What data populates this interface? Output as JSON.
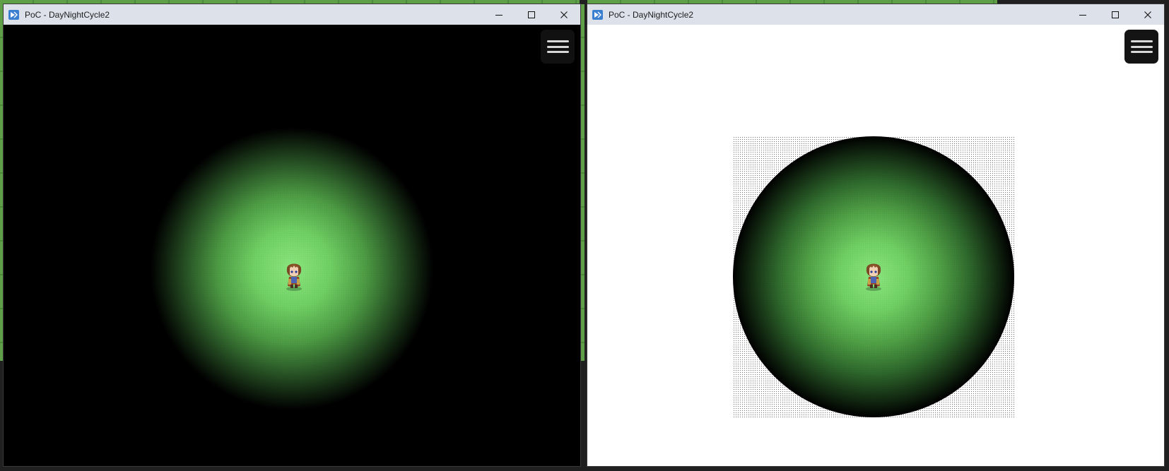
{
  "windows": [
    {
      "title": "PoC - DayNightCycle2",
      "controls": {
        "minimize": "minimize-icon",
        "maximize": "maximize-icon",
        "close": "close-icon"
      },
      "menu_button": "hamburger-menu-icon"
    },
    {
      "title": "PoC - DayNightCycle2",
      "controls": {
        "minimize": "minimize-icon",
        "maximize": "maximize-icon",
        "close": "close-icon"
      },
      "menu_button": "hamburger-menu-icon"
    }
  ],
  "colors": {
    "titlebar": "#dde1ea",
    "night_black": "#000000",
    "grass_light": "#8ae67f",
    "day_white": "#ffffff"
  }
}
